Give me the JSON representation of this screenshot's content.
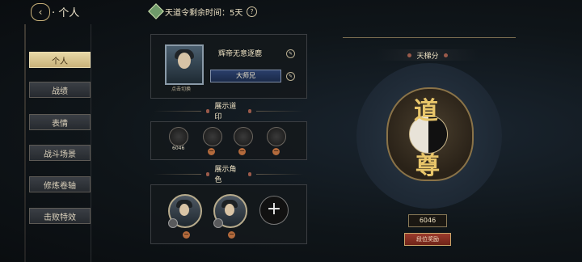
{
  "header": {
    "back_glyph": "‹",
    "title": "· 个人",
    "season_text": "天道令剩余时间：5天",
    "help_glyph": "?"
  },
  "sidebar": {
    "items": [
      {
        "label": "个人",
        "active": true
      },
      {
        "label": "战绩",
        "active": false
      },
      {
        "label": "表情",
        "active": false
      },
      {
        "label": "战斗场景",
        "active": false
      },
      {
        "label": "修炼卷轴",
        "active": false
      },
      {
        "label": "击败特效",
        "active": false
      }
    ]
  },
  "profile": {
    "player_name": "辉帝无意逐鹿",
    "title_plate": "大师兄",
    "switch_hint": "点击切换",
    "edit_glyph": "✎"
  },
  "seals": {
    "header": "展示道印",
    "value": "6046",
    "minus_glyph": "−"
  },
  "characters": {
    "header": "展示角色",
    "add_glyph": "+"
  },
  "rank": {
    "header": "天梯分",
    "char_top": "道",
    "char_bottom": "尊",
    "score": "6046",
    "button_label": "段位奖励"
  },
  "colors": {
    "accent_gold": "#c9b27a",
    "active_tab": "#e8d8a6",
    "minus_orange": "#b36a3c",
    "rank_red": "#9b3a2c"
  }
}
